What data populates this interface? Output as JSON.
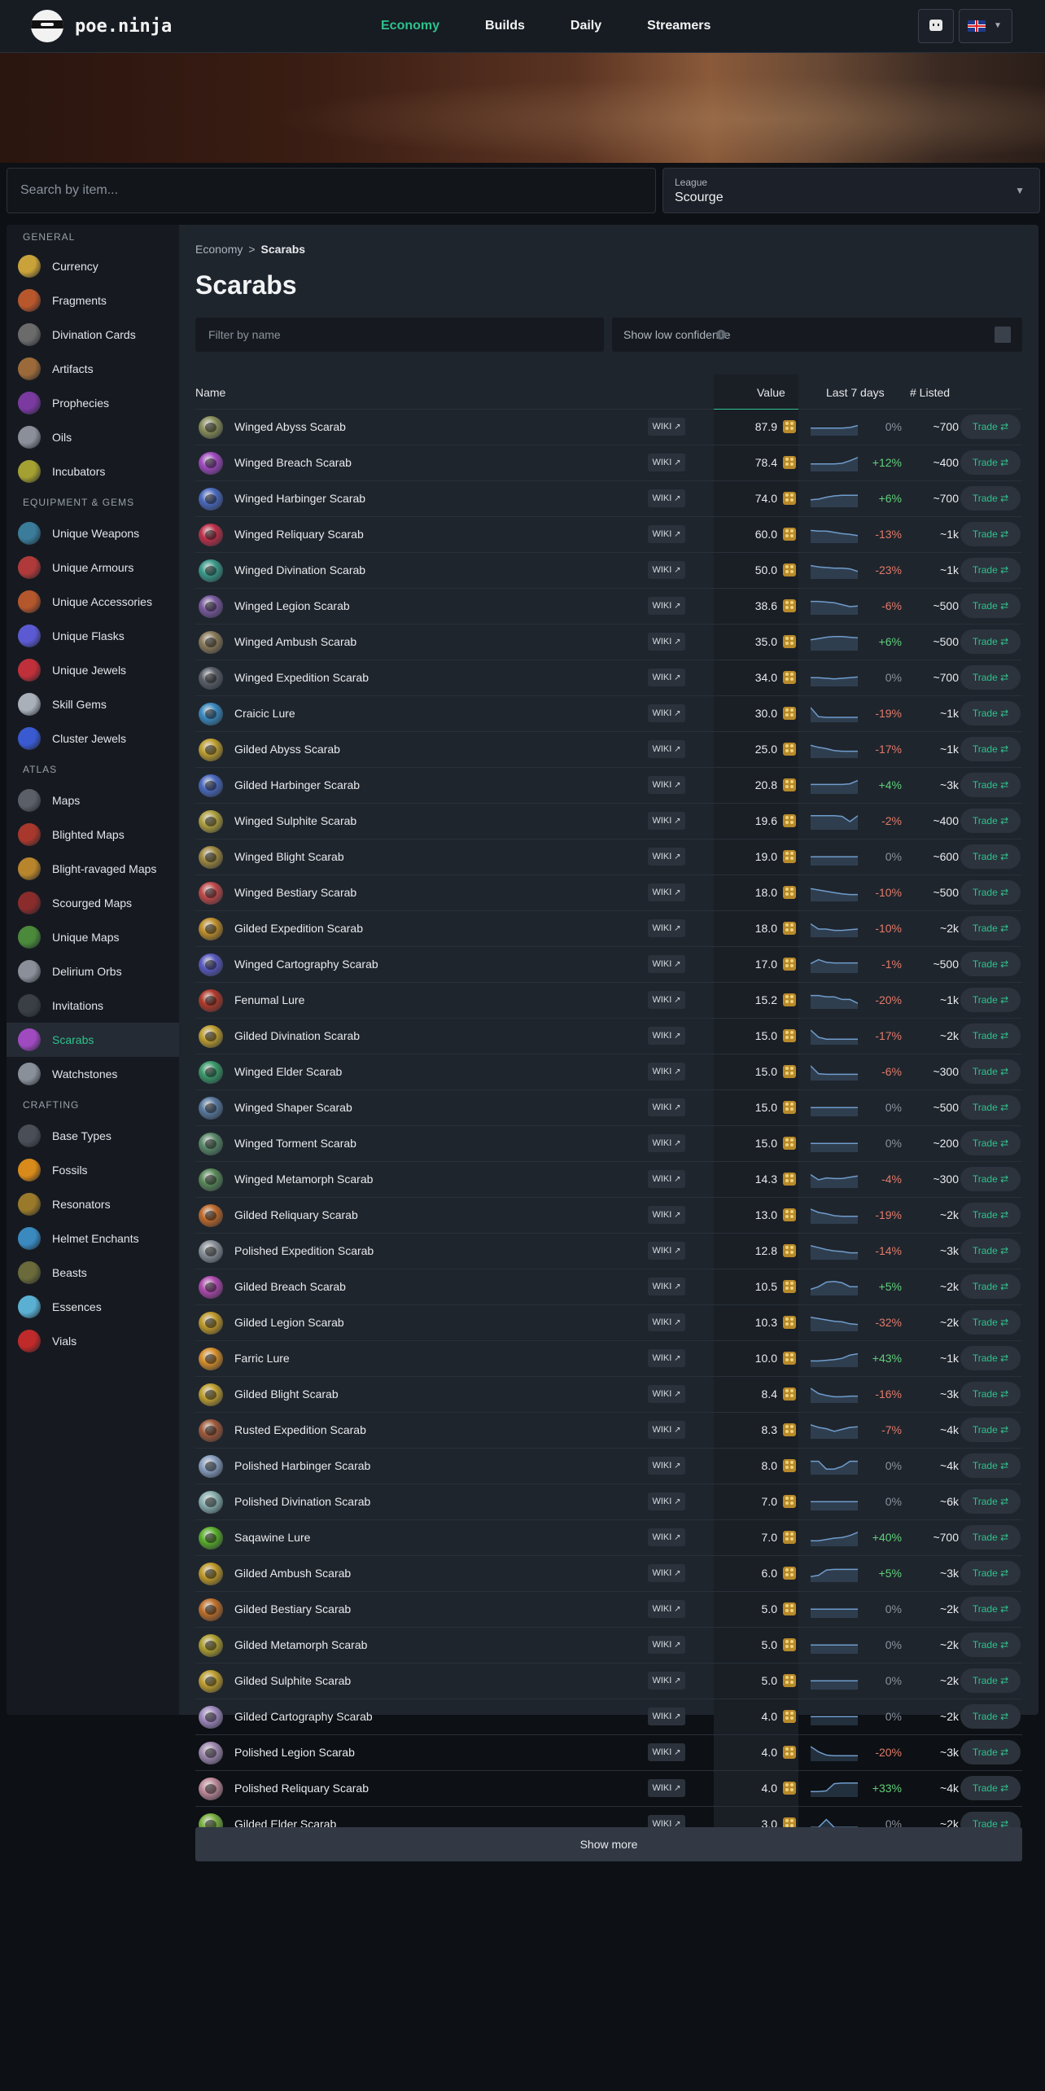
{
  "brand": "poe.ninja",
  "nav": [
    "Economy",
    "Builds",
    "Daily",
    "Streamers"
  ],
  "search_placeholder": "Search by item...",
  "league": {
    "label": "League",
    "value": "Scourge"
  },
  "sidebar": [
    {
      "section": "GENERAL",
      "items": [
        {
          "label": "Currency",
          "color": "#c9a23a"
        },
        {
          "label": "Fragments",
          "color": "#b8572c"
        },
        {
          "label": "Divination Cards",
          "color": "#6b6b6b"
        },
        {
          "label": "Artifacts",
          "color": "#9c6a3a"
        },
        {
          "label": "Prophecies",
          "color": "#7a3aa0"
        },
        {
          "label": "Oils",
          "color": "#8a8f99"
        },
        {
          "label": "Incubators",
          "color": "#a4a032"
        }
      ]
    },
    {
      "section": "EQUIPMENT & GEMS",
      "items": [
        {
          "label": "Unique Weapons",
          "color": "#3a7c9a"
        },
        {
          "label": "Unique Armours",
          "color": "#b03a3a"
        },
        {
          "label": "Unique Accessories",
          "color": "#b5572c"
        },
        {
          "label": "Unique Flasks",
          "color": "#5c5ad2"
        },
        {
          "label": "Unique Jewels",
          "color": "#c0303a"
        },
        {
          "label": "Skill Gems",
          "color": "#aab0ba"
        },
        {
          "label": "Cluster Jewels",
          "color": "#3a5ad2"
        }
      ]
    },
    {
      "section": "ATLAS",
      "items": [
        {
          "label": "Maps",
          "color": "#5a5f68"
        },
        {
          "label": "Blighted Maps",
          "color": "#a8382c"
        },
        {
          "label": "Blight-ravaged Maps",
          "color": "#b8852c"
        },
        {
          "label": "Scourged Maps",
          "color": "#8a2c2c"
        },
        {
          "label": "Unique Maps",
          "color": "#4a8a3a"
        },
        {
          "label": "Delirium Orbs",
          "color": "#8a8f99"
        },
        {
          "label": "Invitations",
          "color": "#3a3f46"
        },
        {
          "label": "Scarabs",
          "color": "#a04ac0",
          "active": true
        },
        {
          "label": "Watchstones",
          "color": "#8a9099"
        }
      ]
    },
    {
      "section": "CRAFTING",
      "items": [
        {
          "label": "Base Types",
          "color": "#4a4f57"
        },
        {
          "label": "Fossils",
          "color": "#d88a1a"
        },
        {
          "label": "Resonators",
          "color": "#9a7a2a"
        },
        {
          "label": "Helmet Enchants",
          "color": "#3a8ac0"
        },
        {
          "label": "Beasts",
          "color": "#6a6a3a"
        },
        {
          "label": "Essences",
          "color": "#5ab0d2"
        },
        {
          "label": "Vials",
          "color": "#c02a2a"
        }
      ]
    }
  ],
  "breadcrumb": {
    "parent": "Economy",
    "sep": ">",
    "current": "Scarabs"
  },
  "page_title": "Scarabs",
  "filter_placeholder": "Filter by name",
  "low_confidence_label": "Show low confidence",
  "info_glyph": "i",
  "columns": {
    "name": "Name",
    "value": "Value",
    "last7": "Last 7 days",
    "listed": "# Listed"
  },
  "wiki_label": "WIKI",
  "trade_label": "Trade",
  "show_more": "Show more",
  "accent_color": "#2fc18c",
  "positive_color": "#5fd07a",
  "negative_color": "#e07a6a",
  "neutral_color": "#8a929c",
  "rows": [
    {
      "name": "Winged Abyss Scarab",
      "value": "87.9",
      "change": "0%",
      "listed": "~700",
      "color": "#8a8f5a",
      "spark": [
        0.55,
        0.55,
        0.55,
        0.55,
        0.55,
        0.5,
        0.35
      ]
    },
    {
      "name": "Winged Breach Scarab",
      "value": "78.4",
      "change": "+12%",
      "listed": "~400",
      "color": "#a04ac0",
      "spark": [
        0.55,
        0.55,
        0.55,
        0.55,
        0.5,
        0.3,
        0.05
      ]
    },
    {
      "name": "Winged Harbinger Scarab",
      "value": "74.0",
      "change": "+6%",
      "listed": "~700",
      "color": "#4a6ac0",
      "spark": [
        0.55,
        0.5,
        0.35,
        0.25,
        0.2,
        0.2,
        0.2
      ]
    },
    {
      "name": "Winged Reliquary Scarab",
      "value": "60.0",
      "change": "-13%",
      "listed": "~1k",
      "color": "#c0304a",
      "spark": [
        0.15,
        0.2,
        0.2,
        0.3,
        0.4,
        0.45,
        0.55
      ]
    },
    {
      "name": "Winged Divination Scarab",
      "value": "50.0",
      "change": "-23%",
      "listed": "~1k",
      "color": "#3a9a8a",
      "spark": [
        0.1,
        0.2,
        0.25,
        0.3,
        0.3,
        0.35,
        0.55
      ]
    },
    {
      "name": "Winged Legion Scarab",
      "value": "38.6",
      "change": "-6%",
      "listed": "~500",
      "color": "#7a5aa0",
      "spark": [
        0.1,
        0.1,
        0.15,
        0.2,
        0.35,
        0.5,
        0.45
      ]
    },
    {
      "name": "Winged Ambush Scarab",
      "value": "35.0",
      "change": "+6%",
      "listed": "~500",
      "color": "#8a7a5a",
      "spark": [
        0.3,
        0.2,
        0.1,
        0.05,
        0.05,
        0.1,
        0.15
      ]
    },
    {
      "name": "Winged Expedition Scarab",
      "value": "34.0",
      "change": "0%",
      "listed": "~700",
      "color": "#5a5f68",
      "spark": [
        0.45,
        0.45,
        0.5,
        0.55,
        0.5,
        0.45,
        0.4
      ]
    },
    {
      "name": "Craicic Lure",
      "value": "30.0",
      "change": "-19%",
      "listed": "~1k",
      "color": "#3a8ac0",
      "spark": [
        0.0,
        0.7,
        0.75,
        0.75,
        0.75,
        0.75,
        0.75
      ]
    },
    {
      "name": "Gilded Abyss Scarab",
      "value": "25.0",
      "change": "-17%",
      "listed": "~1k",
      "color": "#c0a030",
      "spark": [
        0.15,
        0.3,
        0.4,
        0.55,
        0.6,
        0.6,
        0.6
      ]
    },
    {
      "name": "Gilded Harbinger Scarab",
      "value": "20.8",
      "change": "+4%",
      "listed": "~3k",
      "color": "#4a6ac0",
      "spark": [
        0.4,
        0.4,
        0.4,
        0.4,
        0.4,
        0.35,
        0.1
      ]
    },
    {
      "name": "Winged Sulphite Scarab",
      "value": "19.6",
      "change": "-2%",
      "listed": "~400",
      "color": "#b0a040",
      "spark": [
        0.05,
        0.05,
        0.05,
        0.05,
        0.1,
        0.5,
        0.05
      ]
    },
    {
      "name": "Winged Blight Scarab",
      "value": "19.0",
      "change": "0%",
      "listed": "~600",
      "color": "#a08a40",
      "spark": [
        0.45,
        0.45,
        0.45,
        0.45,
        0.45,
        0.45,
        0.45
      ]
    },
    {
      "name": "Winged Bestiary Scarab",
      "value": "18.0",
      "change": "-10%",
      "listed": "~500",
      "color": "#c04a4a",
      "spark": [
        0.15,
        0.25,
        0.35,
        0.45,
        0.55,
        0.6,
        0.6
      ]
    },
    {
      "name": "Gilded Expedition Scarab",
      "value": "18.0",
      "change": "-10%",
      "listed": "~2k",
      "color": "#c0902a",
      "spark": [
        0.1,
        0.5,
        0.5,
        0.6,
        0.6,
        0.55,
        0.5
      ]
    },
    {
      "name": "Winged Cartography Scarab",
      "value": "17.0",
      "change": "-1%",
      "listed": "~500",
      "color": "#5a5ac0",
      "spark": [
        0.4,
        0.1,
        0.3,
        0.35,
        0.35,
        0.35,
        0.35
      ]
    },
    {
      "name": "Fenumal Lure",
      "value": "15.2",
      "change": "-20%",
      "listed": "~1k",
      "color": "#b03a2a",
      "spark": [
        0.1,
        0.1,
        0.2,
        0.2,
        0.4,
        0.4,
        0.7
      ]
    },
    {
      "name": "Gilded Divination Scarab",
      "value": "15.0",
      "change": "-17%",
      "listed": "~2k",
      "color": "#c0a030",
      "spark": [
        0.0,
        0.55,
        0.7,
        0.7,
        0.7,
        0.7,
        0.7
      ]
    },
    {
      "name": "Winged Elder Scarab",
      "value": "15.0",
      "change": "-6%",
      "listed": "~300",
      "color": "#3a9a6a",
      "spark": [
        0.0,
        0.6,
        0.65,
        0.65,
        0.65,
        0.65,
        0.65
      ]
    },
    {
      "name": "Winged Shaper Scarab",
      "value": "15.0",
      "change": "0%",
      "listed": "~500",
      "color": "#5a7aa0",
      "spark": [
        0.45,
        0.45,
        0.45,
        0.45,
        0.45,
        0.45,
        0.45
      ]
    },
    {
      "name": "Winged Torment Scarab",
      "value": "15.0",
      "change": "0%",
      "listed": "~200",
      "color": "#5a8a6a",
      "spark": [
        0.45,
        0.45,
        0.45,
        0.45,
        0.45,
        0.45,
        0.45
      ]
    },
    {
      "name": "Winged Metamorph Scarab",
      "value": "14.3",
      "change": "-4%",
      "listed": "~300",
      "color": "#5a8a5a",
      "spark": [
        0.1,
        0.5,
        0.35,
        0.4,
        0.4,
        0.3,
        0.2
      ]
    },
    {
      "name": "Gilded Reliquary Scarab",
      "value": "13.0",
      "change": "-19%",
      "listed": "~2k",
      "color": "#c06a2a",
      "spark": [
        0.0,
        0.25,
        0.35,
        0.5,
        0.55,
        0.55,
        0.55
      ]
    },
    {
      "name": "Polished Expedition Scarab",
      "value": "12.8",
      "change": "-14%",
      "listed": "~3k",
      "color": "#8a9099",
      "spark": [
        0.05,
        0.2,
        0.35,
        0.45,
        0.5,
        0.6,
        0.6
      ]
    },
    {
      "name": "Gilded Breach Scarab",
      "value": "10.5",
      "change": "+5%",
      "listed": "~2k",
      "color": "#b04ab0",
      "spark": [
        0.65,
        0.45,
        0.1,
        0.05,
        0.15,
        0.45,
        0.45
      ]
    },
    {
      "name": "Gilded Legion Scarab",
      "value": "10.3",
      "change": "-32%",
      "listed": "~2k",
      "color": "#c09a2a",
      "spark": [
        0.05,
        0.15,
        0.25,
        0.35,
        0.4,
        0.55,
        0.6
      ]
    },
    {
      "name": "Farric Lure",
      "value": "10.0",
      "change": "+43%",
      "listed": "~1k",
      "color": "#d8902a",
      "spark": [
        0.65,
        0.65,
        0.6,
        0.55,
        0.45,
        0.2,
        0.1
      ]
    },
    {
      "name": "Gilded Blight Scarab",
      "value": "8.4",
      "change": "-16%",
      "listed": "~3k",
      "color": "#c0a030",
      "spark": [
        0.0,
        0.4,
        0.55,
        0.65,
        0.65,
        0.6,
        0.6
      ]
    },
    {
      "name": "Rusted Expedition Scarab",
      "value": "8.3",
      "change": "-7%",
      "listed": "~4k",
      "color": "#a05a3a",
      "spark": [
        0.05,
        0.25,
        0.35,
        0.55,
        0.4,
        0.25,
        0.2
      ]
    },
    {
      "name": "Polished Harbinger Scarab",
      "value": "8.0",
      "change": "0%",
      "listed": "~4k",
      "color": "#8aa0c0",
      "spark": [
        0.1,
        0.1,
        0.7,
        0.7,
        0.5,
        0.1,
        0.1
      ]
    },
    {
      "name": "Polished Divination Scarab",
      "value": "7.0",
      "change": "0%",
      "listed": "~6k",
      "color": "#8ab0b0",
      "spark": [
        0.45,
        0.45,
        0.45,
        0.45,
        0.45,
        0.45,
        0.45
      ]
    },
    {
      "name": "Saqawine Lure",
      "value": "7.0",
      "change": "+40%",
      "listed": "~700",
      "color": "#5ab02a",
      "spark": [
        0.7,
        0.7,
        0.6,
        0.5,
        0.45,
        0.3,
        0.05
      ]
    },
    {
      "name": "Gilded Ambush Scarab",
      "value": "6.0",
      "change": "+5%",
      "listed": "~3k",
      "color": "#c09a2a",
      "spark": [
        0.7,
        0.6,
        0.2,
        0.15,
        0.15,
        0.15,
        0.15
      ]
    },
    {
      "name": "Gilded Bestiary Scarab",
      "value": "5.0",
      "change": "0%",
      "listed": "~2k",
      "color": "#c0702a",
      "spark": [
        0.45,
        0.45,
        0.45,
        0.45,
        0.45,
        0.45,
        0.45
      ]
    },
    {
      "name": "Gilded Metamorph Scarab",
      "value": "5.0",
      "change": "0%",
      "listed": "~2k",
      "color": "#b0a030",
      "spark": [
        0.45,
        0.45,
        0.45,
        0.45,
        0.45,
        0.45,
        0.45
      ]
    },
    {
      "name": "Gilded Sulphite Scarab",
      "value": "5.0",
      "change": "0%",
      "listed": "~2k",
      "color": "#c0a030",
      "spark": [
        0.45,
        0.45,
        0.45,
        0.45,
        0.45,
        0.45,
        0.45
      ]
    },
    {
      "name": "Gilded Cartography Scarab",
      "value": "4.0",
      "change": "0%",
      "listed": "~2k",
      "color": "#a08ac0",
      "spark": [
        0.45,
        0.45,
        0.45,
        0.45,
        0.45,
        0.45,
        0.45
      ]
    },
    {
      "name": "Polished Legion Scarab",
      "value": "4.0",
      "change": "-20%",
      "listed": "~3k",
      "color": "#a08ab0",
      "spark": [
        0.0,
        0.4,
        0.65,
        0.7,
        0.7,
        0.7,
        0.7
      ]
    },
    {
      "name": "Polished Reliquary Scarab",
      "value": "4.0",
      "change": "+33%",
      "listed": "~4k",
      "color": "#c08a9a",
      "spark": [
        0.7,
        0.7,
        0.65,
        0.1,
        0.05,
        0.05,
        0.05
      ]
    },
    {
      "name": "Gilded Elder Scarab",
      "value": "3.0",
      "change": "0%",
      "listed": "~2k",
      "color": "#7ab040",
      "spark": [
        0.7,
        0.7,
        0.1,
        0.7,
        0.7,
        0.7,
        0.7
      ]
    }
  ]
}
